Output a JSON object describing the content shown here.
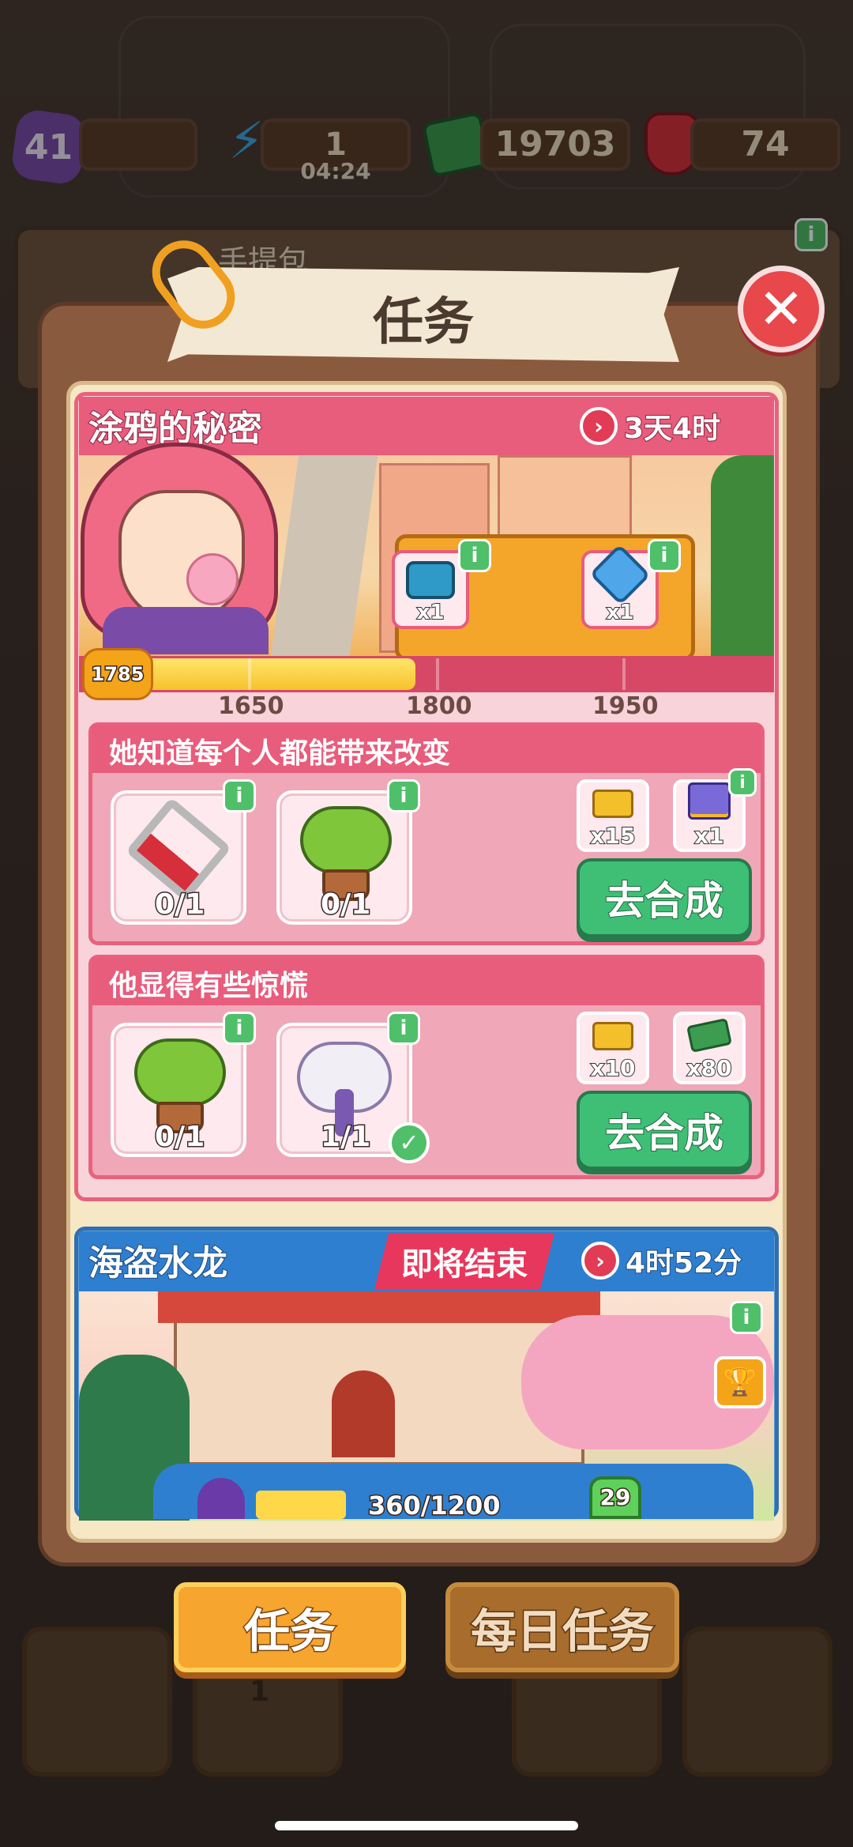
{
  "topbar": {
    "level": "41",
    "energy": "1",
    "energy_timer": "04:24",
    "cash": "19703",
    "gems": "74"
  },
  "background": {
    "bag_label": "手提包"
  },
  "panel": {
    "title": "任务"
  },
  "event1": {
    "title": "涂鸦的秘密",
    "time_left": "3天4时",
    "progress_value": "1785",
    "milestones": [
      "1650",
      "1800",
      "1950"
    ],
    "rewards": [
      {
        "icon": "chest-icon",
        "qty": "x1"
      },
      {
        "icon": "hourglass-icon",
        "qty": "x1"
      }
    ],
    "tasks": [
      {
        "title": "她知道每个人都能带来改变",
        "items": [
          {
            "icon": "saw-icon",
            "count": "0/1"
          },
          {
            "icon": "tree-icon",
            "count": "0/1"
          }
        ],
        "rewards": [
          {
            "icon": "gold-bars-icon",
            "qty": "x15"
          },
          {
            "icon": "gift-box-icon",
            "qty": "x1"
          }
        ],
        "button": "去合成"
      },
      {
        "title": "他显得有些惊慌",
        "items": [
          {
            "icon": "tree-icon",
            "count": "0/1"
          },
          {
            "icon": "cotton-icon",
            "count": "1/1"
          }
        ],
        "rewards": [
          {
            "icon": "gold-bars-icon",
            "qty": "x10"
          },
          {
            "icon": "cash-icon",
            "qty": "x80"
          }
        ],
        "button": "去合成"
      }
    ]
  },
  "event2": {
    "title": "海盗水龙",
    "status": "即将结束",
    "time_left": "4时52分",
    "progress_text": "360/1200",
    "level_badge": "29"
  },
  "tabs": {
    "tasks": "任务",
    "daily": "每日任务"
  },
  "background_nav": {
    "trophy_count": "1"
  },
  "colors": {
    "event1_accent": "#e85c7c",
    "event2_accent": "#2f7fd0",
    "go_button": "#3fbf76",
    "active_tab": "#f6a52e"
  }
}
